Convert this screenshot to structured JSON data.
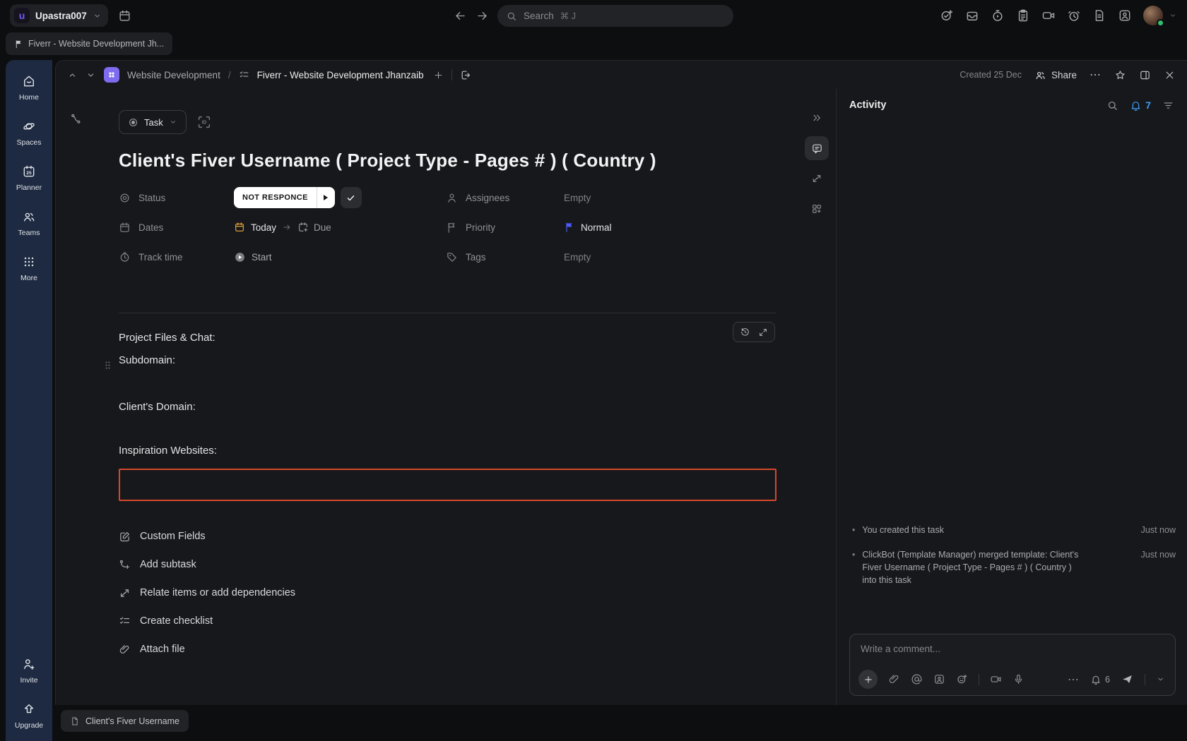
{
  "topbar": {
    "workspace": {
      "name": "Upastra007",
      "logo_letter": "u"
    },
    "search": {
      "placeholder": "Search",
      "shortcut": "⌘ J"
    },
    "right_icons": [
      "new-task",
      "tray",
      "timer",
      "notepad",
      "clip-recorder",
      "reminder",
      "docs",
      "contacts"
    ]
  },
  "tabbar": {
    "tab_label": "Fiverr - Website Development Jh..."
  },
  "sidebar": {
    "items": [
      {
        "label": "Home",
        "icon": "home"
      },
      {
        "label": "Spaces",
        "icon": "planet"
      },
      {
        "label": "Planner",
        "icon": "calendar-25",
        "calendar_day": "25"
      },
      {
        "label": "Teams",
        "icon": "people"
      },
      {
        "label": "More",
        "icon": "grid-dots"
      }
    ],
    "footer": [
      {
        "label": "Invite",
        "icon": "person-plus"
      },
      {
        "label": "Upgrade",
        "icon": "arrow-up"
      }
    ]
  },
  "header": {
    "breadcrumb_space": "Website Development",
    "breadcrumb_sep": "/",
    "breadcrumb_task": "Fiverr - Website Development Jhanzaib",
    "created": "Created 25 Dec",
    "share_label": "Share"
  },
  "task": {
    "type_label": "Task",
    "title": "Client's Fiver Username ( Project Type - Pages # ) ( Country )",
    "fields": {
      "status": {
        "label": "Status",
        "value": "NOT RESPONCE"
      },
      "assignees": {
        "label": "Assignees",
        "value": "Empty"
      },
      "dates": {
        "label": "Dates",
        "start": "Today",
        "due": "Due"
      },
      "priority": {
        "label": "Priority",
        "value": "Normal"
      },
      "track_time": {
        "label": "Track time",
        "value": "Start"
      },
      "tags": {
        "label": "Tags",
        "value": "Empty"
      }
    },
    "description": [
      "Project Files & Chat:",
      "Subdomain:",
      "Client's Domain:",
      "Inspiration Websites:"
    ],
    "actions": [
      "Custom Fields",
      "Add subtask",
      "Relate items or add dependencies",
      "Create checklist",
      "Attach file"
    ]
  },
  "activity": {
    "title": "Activity",
    "bell_count": "7",
    "entries": [
      {
        "text": "You created this task",
        "time": "Just now"
      },
      {
        "text": "ClickBot (Template Manager) merged template: Client's Fiver Username ( Project Type - Pages # ) ( Country ) into this task",
        "time": "Just now"
      }
    ],
    "comment": {
      "placeholder": "Write a comment...",
      "bell_count": "6"
    }
  },
  "footer": {
    "doc_tab": "Client's Fiver Username"
  },
  "colors": {
    "sidebar_navy": "#1d2a41",
    "panel_bg": "#17181b",
    "status_pill_bg": "#ffffff",
    "priority_flag_blue": "#4c5bfb",
    "today_yellow": "#edaa3c",
    "notification_blue": "#3f9ef6",
    "highlight_red_border": "#d5492b",
    "breadcrumb_purple": "#7d6cf0",
    "online_green": "#2fbf71"
  }
}
